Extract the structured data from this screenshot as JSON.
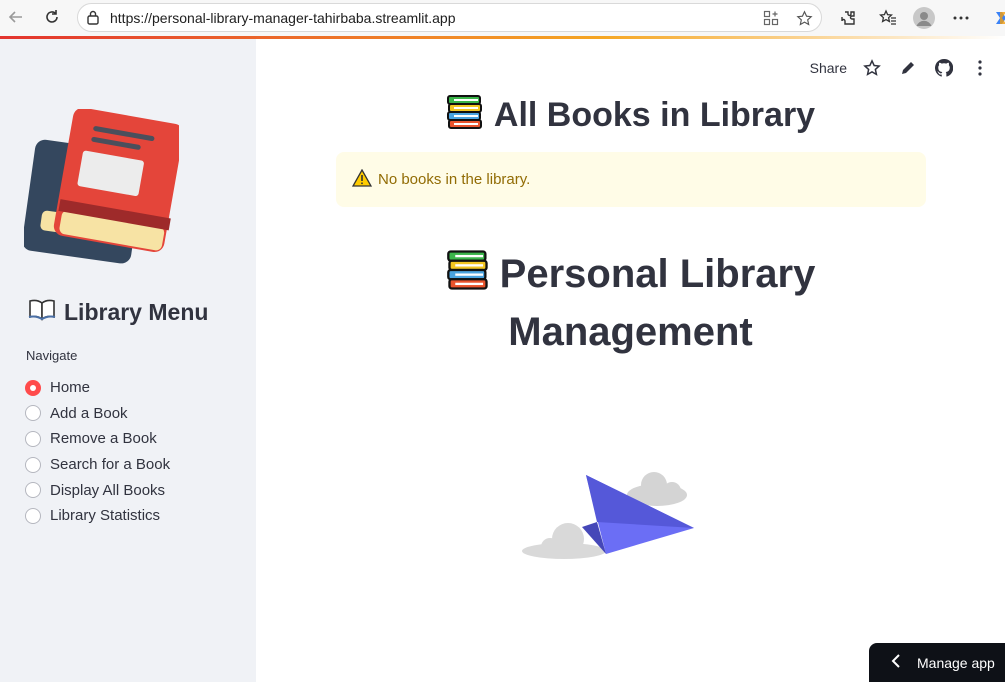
{
  "browser": {
    "url": "https://personal-library-manager-tahirbaba.streamlit.app",
    "icons": [
      "back-icon",
      "reload-icon",
      "lock-icon",
      "apps-icon",
      "star-icon",
      "extensions-icon",
      "favorites-icon",
      "profile-icon",
      "more-icon",
      "copilot-icon"
    ]
  },
  "sidebar": {
    "title": "Library Menu",
    "nav_label": "Navigate",
    "options": [
      {
        "label": "Home",
        "selected": true
      },
      {
        "label": "Add a Book",
        "selected": false
      },
      {
        "label": "Remove a Book",
        "selected": false
      },
      {
        "label": "Search for a Book",
        "selected": false
      },
      {
        "label": "Display All Books",
        "selected": false
      },
      {
        "label": "Library Statistics",
        "selected": false
      }
    ]
  },
  "toolbar": {
    "share_label": "Share"
  },
  "main": {
    "heading1": "All Books in Library",
    "alert_text": "No books in the library.",
    "heading2_line1": "Personal Library",
    "heading2_line2": "Management"
  },
  "manage_app_label": "Manage app",
  "colors": {
    "accent": "#ff4b4b",
    "sidebar_bg": "#f0f2f6",
    "alert_bg": "#fffce7",
    "alert_text": "#926c05"
  }
}
